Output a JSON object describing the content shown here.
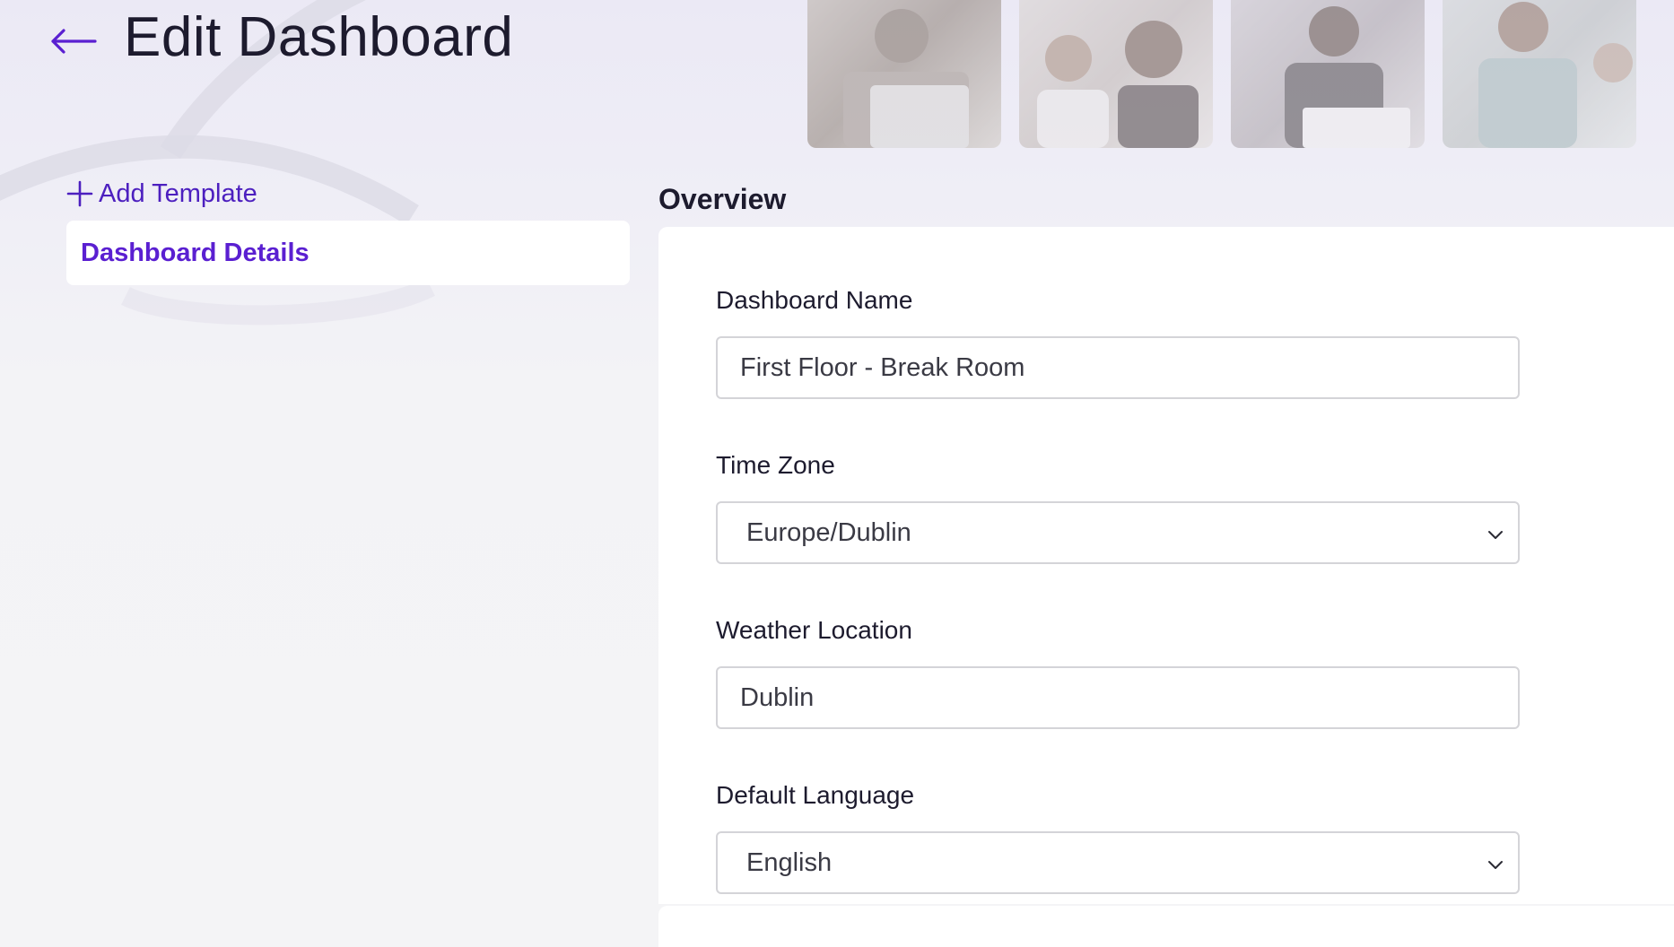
{
  "header": {
    "title": "Edit Dashboard",
    "back_icon": "arrow-left-icon"
  },
  "sidebar": {
    "add_template_label": "Add Template",
    "add_icon": "plus-icon",
    "items": [
      {
        "label": "Dashboard Details",
        "active": true
      }
    ]
  },
  "main": {
    "section_title": "Overview",
    "fields": {
      "dashboard_name": {
        "label": "Dashboard Name",
        "value": "First Floor - Break Room"
      },
      "time_zone": {
        "label": "Time Zone",
        "value": "Europe/Dublin"
      },
      "weather_location": {
        "label": "Weather Location",
        "value": "Dublin"
      },
      "default_language": {
        "label": "Default Language",
        "value": "English"
      }
    }
  },
  "colors": {
    "accent": "#5a1fd1",
    "text": "#1d1b2e",
    "input_border": "#d4d4d8"
  }
}
